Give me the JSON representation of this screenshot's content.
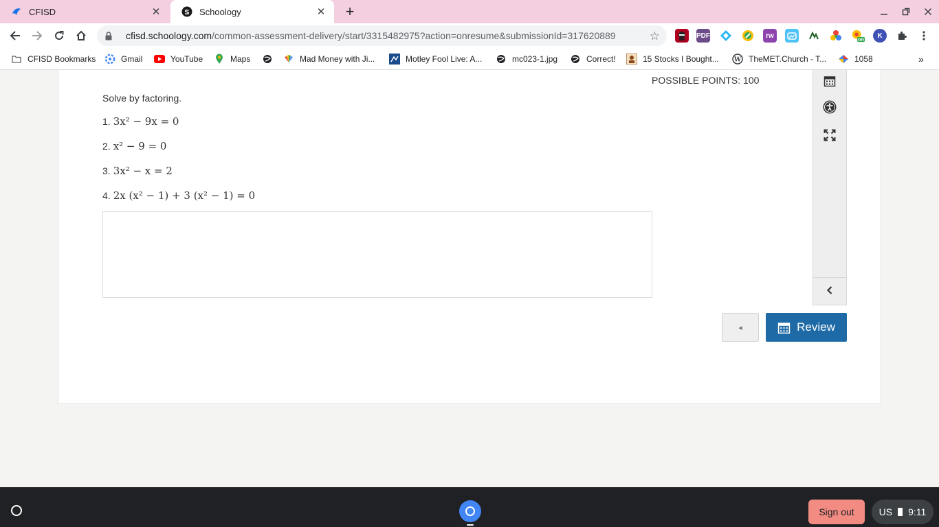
{
  "browser": {
    "tabs": [
      {
        "title": "CFISD",
        "active": false
      },
      {
        "title": "Schoology",
        "active": true
      }
    ],
    "address": {
      "host": "cfisd.schoology.com",
      "path": "/common-assessment-delivery/start/3315482975?action=onresume&submissionId=317620889"
    },
    "bookmarks": [
      {
        "label": "CFISD Bookmarks",
        "icon": "folder-icon"
      },
      {
        "label": "Gmail",
        "icon": "gmail-icon"
      },
      {
        "label": "YouTube",
        "icon": "youtube-icon"
      },
      {
        "label": "Maps",
        "icon": "maps-icon"
      },
      {
        "label": "",
        "icon": "globe-icon"
      },
      {
        "label": "Mad Money with Ji...",
        "icon": "nbc-icon"
      },
      {
        "label": "Motley Fool Live: A...",
        "icon": "motley-fool-icon"
      },
      {
        "label": "mc023-1.jpg",
        "icon": "globe-icon"
      },
      {
        "label": "Correct!",
        "icon": "globe-icon"
      },
      {
        "label": "15 Stocks I Bought...",
        "icon": "stocks-icon"
      },
      {
        "label": "TheMET.Church - T...",
        "icon": "wordpress-icon"
      },
      {
        "label": "1058",
        "icon": "diamond-icon"
      }
    ]
  },
  "assessment": {
    "possible_points": "POSSIBLE POINTS: 100",
    "instructions": "Solve by factoring.",
    "problems": [
      {
        "number": "1.",
        "expression": "3x² − 9x = 0"
      },
      {
        "number": "2.",
        "expression": "x² − 9 = 0"
      },
      {
        "number": "3.",
        "expression": "3x² − x = 2"
      },
      {
        "number": "4.",
        "expression": "2x (x² − 1) + 3 (x² − 1) = 0"
      }
    ],
    "answer_value": "",
    "review_label": "Review",
    "prev_label": "◂"
  },
  "shelf": {
    "signout_label": "Sign out",
    "locale": "US",
    "time": "9:11"
  },
  "colors": {
    "tabstrip": "#f4cfe0",
    "review_button": "#1e6aa6",
    "signout_button": "#f28b82"
  }
}
